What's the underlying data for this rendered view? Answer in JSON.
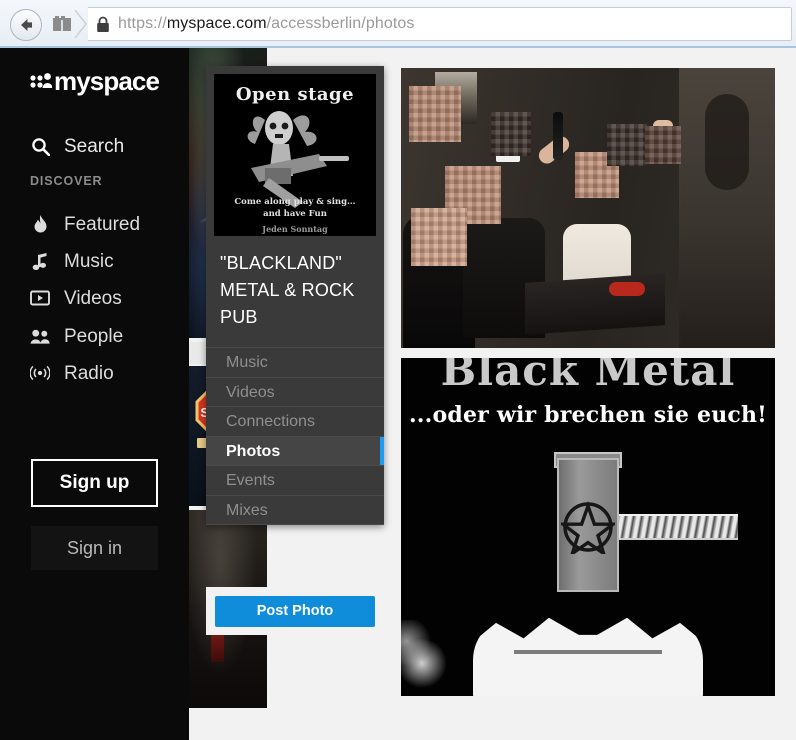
{
  "browser": {
    "back_icon": "back-arrow-icon",
    "tab_icon": "tab-grid-icon",
    "lock_icon": "padlock-icon",
    "url_scheme": "https://",
    "url_host": "myspace.com",
    "url_path": "/accessberlin/photos",
    "url_full": "https://myspace.com/accessberlin/photos"
  },
  "sidebar": {
    "logo_text": "myspace",
    "logo_icon": "myspace-dots-icon",
    "search": {
      "label": "Search",
      "icon": "search-icon"
    },
    "section_label": "DISCOVER",
    "items": [
      {
        "label": "Featured",
        "icon": "flame-icon"
      },
      {
        "label": "Music",
        "icon": "music-note-icon"
      },
      {
        "label": "Videos",
        "icon": "video-play-icon"
      },
      {
        "label": "People",
        "icon": "people-icon"
      },
      {
        "label": "Radio",
        "icon": "radio-waves-icon"
      }
    ],
    "sign_up": "Sign up",
    "sign_in": "Sign in"
  },
  "profile_card": {
    "avatar": {
      "title": "Open stage",
      "caption_line1": "Come along play & sing…",
      "caption_line2": "and have Fun",
      "caption_line3": "Jeden Sonntag"
    },
    "name": "\"BLACKLAND\" METAL & ROCK PUB",
    "menu": [
      {
        "label": "Music",
        "active": false
      },
      {
        "label": "Videos",
        "active": false
      },
      {
        "label": "Connections",
        "active": false
      },
      {
        "label": "Photos",
        "active": true
      },
      {
        "label": "Events",
        "active": false
      },
      {
        "label": "Mixes",
        "active": false
      }
    ],
    "post_photo_label": "Post Photo"
  },
  "photos": [
    {
      "name": "pub-group-photo",
      "alt": "Group of people in a pub, faces pixelated, one man raising a beer bottle and making horns sign"
    },
    {
      "name": "black-metal-poster",
      "title": "Black Metal",
      "subtitle": "...oder wir brechen sie euch!",
      "alt": "Black metal poster with hammer, pentagram and hands"
    }
  ],
  "colors": {
    "accent_blue": "#0f8ddb",
    "active_indicator": "#1d9bf0",
    "sidebar_bg": "#0a0a0a",
    "card_bg": "#3a3a3a",
    "page_bg": "#f2f2f2"
  }
}
